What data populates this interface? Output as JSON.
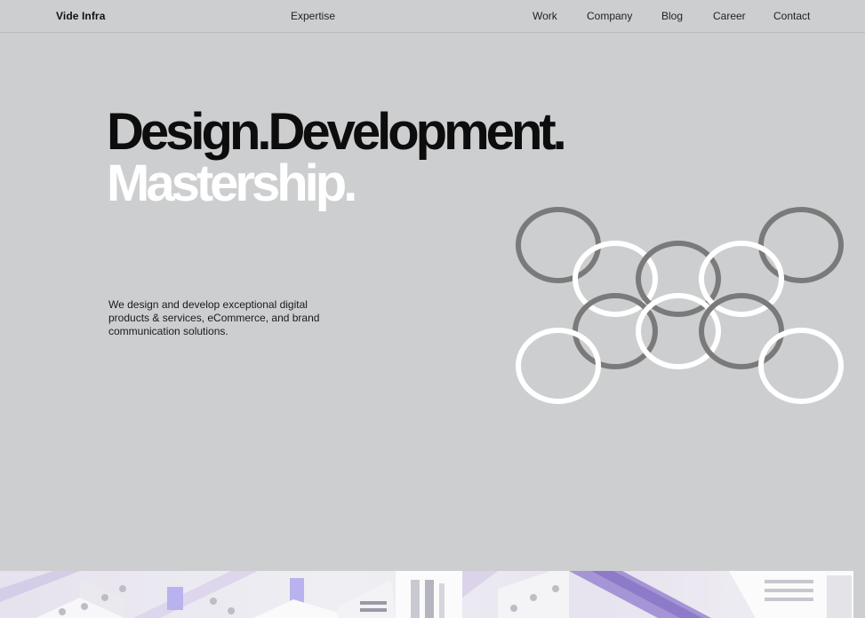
{
  "header": {
    "brand": "Vide Infra",
    "nav_center": "Expertise",
    "nav_right": [
      "Work",
      "Company",
      "Blog",
      "Career",
      "Contact"
    ]
  },
  "hero": {
    "headline_line1": "Design.Development.",
    "headline_line2": "Mastership.",
    "description": "We design and develop exceptional digital products & services, eCommerce, and brand communication solutions."
  },
  "colors": {
    "background": "#cdcecf",
    "headline_dark": "#0d0d0d",
    "headline_light": "#ffffff",
    "ring_white": "#ffffff",
    "ring_gray": "#7a7a7a",
    "banner_accent": "#8d7bc9"
  }
}
